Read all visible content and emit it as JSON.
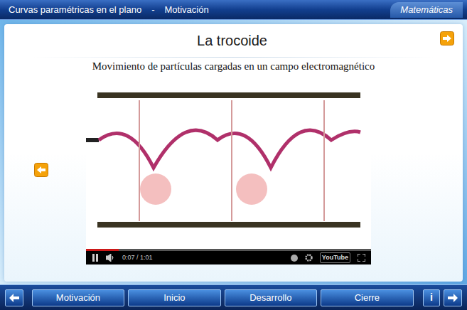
{
  "header": {
    "title": "Curvas paramétricas en el plano",
    "separator": "-",
    "section": "Motivación",
    "subject": "Matemáticas"
  },
  "page": {
    "title": "La trocoide",
    "subtitle": "Movimiento de partículas cargadas en un campo electromagnético"
  },
  "video": {
    "time": "0:07 / 1:01",
    "playing": true,
    "level": 0.115,
    "logo": "YouTube"
  },
  "nav": {
    "buttons": [
      {
        "label": "Motivación",
        "selected": false
      },
      {
        "label": "Inicio",
        "selected": false
      },
      {
        "label": "Desarrollo",
        "selected": false
      },
      {
        "label": "Cierre",
        "selected": false
      }
    ],
    "info": "i"
  }
}
